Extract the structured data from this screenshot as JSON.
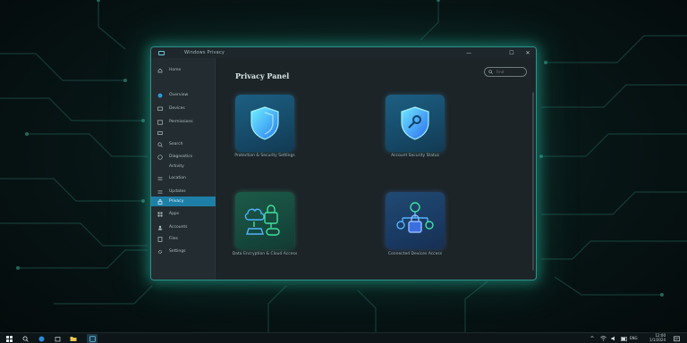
{
  "window": {
    "title": "Windows Privacy",
    "controls": {
      "minimize": "—",
      "maximize": "☐",
      "close": "✕"
    }
  },
  "sidebar": {
    "items": [
      {
        "label": "Home",
        "icon": "home-icon"
      },
      {
        "label": "Overview",
        "icon": "globe-icon"
      },
      {
        "label": "Devices",
        "icon": "monitor-icon"
      },
      {
        "label": "Permissions",
        "icon": "window-icon"
      },
      {
        "label": "",
        "icon": "devices-icon"
      },
      {
        "label": "Search",
        "icon": "search-icon"
      },
      {
        "label": "Diagnostics",
        "icon": "clock-icon"
      },
      {
        "label": "Activity",
        "icon": ""
      },
      {
        "label": "Location",
        "icon": "list-icon"
      },
      {
        "label": "Updates",
        "icon": "list-icon"
      },
      {
        "label": "Privacy",
        "icon": "lock-icon",
        "active": true
      },
      {
        "label": "Apps",
        "icon": "grid-icon"
      },
      {
        "label": "Accounts",
        "icon": "user-icon"
      },
      {
        "label": "Files",
        "icon": "doc-icon"
      },
      {
        "label": "Settings",
        "icon": "gear-icon"
      }
    ]
  },
  "main": {
    "title": "Privacy Panel",
    "search_placeholder": "Find"
  },
  "cards": [
    {
      "label": "Protection & Security Settings",
      "icon": "shield-icon",
      "tone": "blue"
    },
    {
      "label": "Account Security Status",
      "icon": "shield-key-icon",
      "tone": "blue"
    },
    {
      "label": "Data Encryption & Cloud Access",
      "icon": "cloud-lock-icon",
      "tone": "green"
    },
    {
      "label": "Connected Devices Access",
      "icon": "network-lock-icon",
      "tone": "indigo"
    }
  ],
  "taskbar": {
    "time": "12:00",
    "date": "1/1/2024",
    "tray_language": "ENG"
  },
  "colors": {
    "accent": "#1e7fa6",
    "window_glow": "#28c8aa",
    "shield_blue": "#39b8ff",
    "lock_green": "#42e0a0"
  }
}
